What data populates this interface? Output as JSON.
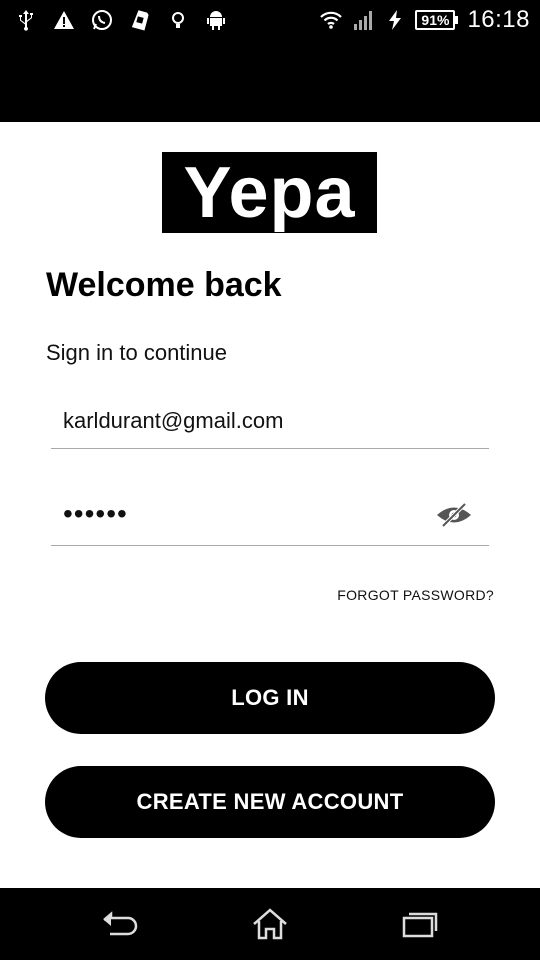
{
  "status_bar": {
    "notification_icons": [
      "usb-icon",
      "warning-icon",
      "whatsapp-icon",
      "sim-card-icon",
      "lightbulb-icon",
      "android-icon"
    ],
    "system_icons": [
      "wifi-icon",
      "signal-icon",
      "charging-icon"
    ],
    "battery": "91%",
    "time": "16:18"
  },
  "logo": {
    "text": "Yepa"
  },
  "header": {
    "title": "Welcome back",
    "subtitle": "Sign in to continue"
  },
  "form": {
    "email_value": "karldurant@gmail.com",
    "password_value": "••••••",
    "password_visibility_icon": "eye-off-icon",
    "forgot_password_label": "FORGOT PASSWORD?"
  },
  "actions": {
    "login_label": "LOG IN",
    "create_account_label": "CREATE NEW ACCOUNT"
  },
  "navigation_bar": {
    "icons": [
      "back-icon",
      "home-icon",
      "recent-apps-icon"
    ]
  },
  "colors": {
    "primary": "#000000",
    "background": "#ffffff",
    "divider": "#a9a9a9"
  }
}
